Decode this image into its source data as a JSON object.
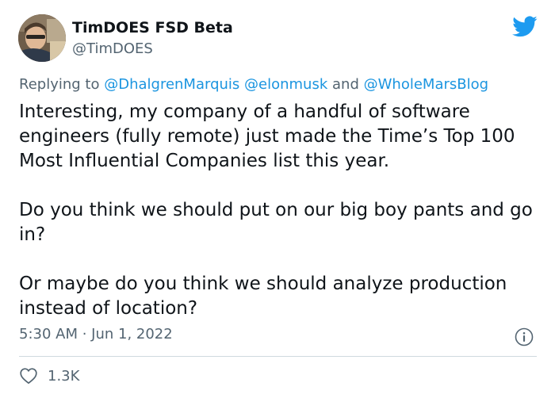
{
  "author": {
    "display_name": "TimDOES FSD Beta",
    "handle": "@TimDOES"
  },
  "reply": {
    "prefix": "Replying to",
    "conjunction": "and",
    "mentions": [
      "@DhalgrenMarquis",
      "@elonmusk",
      "@WholeMarsBlog"
    ]
  },
  "tweet": {
    "paragraphs": [
      "Interesting, my company of a handful of software engineers (fully remote) just made the Time’s Top 100 Most Influential Companies list this year.",
      "Do you think we should put on our big boy pants and go in?",
      "Or maybe do you think we should analyze production instead of location?"
    ],
    "timestamp": "5:30 AM · Jun 1, 2022"
  },
  "stats": {
    "likes": "1.3K"
  },
  "icons": {
    "brand": "twitter-bird-icon",
    "info": "info-icon",
    "like": "heart-icon"
  },
  "colors": {
    "brand_blue": "#1d9bf0",
    "mention_blue": "#1b95e0",
    "secondary_text": "#536471",
    "primary_text": "#0f1419",
    "divider": "#cfd9de"
  }
}
